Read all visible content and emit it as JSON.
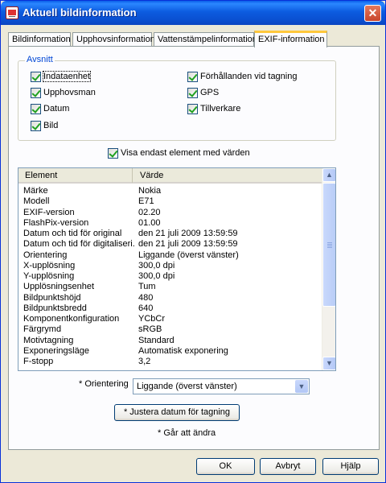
{
  "window": {
    "title": "Aktuell bildinformation",
    "close_glyph": "✕"
  },
  "tabs": [
    {
      "label": "Bildinformation"
    },
    {
      "label": "Upphovsinformation"
    },
    {
      "label": "Vattenstämpelinformation"
    },
    {
      "label": "EXIF-information",
      "active": true
    }
  ],
  "sections": {
    "legend": "Avsnitt",
    "items": [
      {
        "label": "Indataenhet",
        "checked": true
      },
      {
        "label": "Upphovsman",
        "checked": true
      },
      {
        "label": "Datum",
        "checked": true
      },
      {
        "label": "Bild",
        "checked": true
      },
      {
        "label": "Förhållanden vid tagning",
        "checked": true
      },
      {
        "label": "GPS",
        "checked": true
      },
      {
        "label": "Tillverkare",
        "checked": true
      }
    ]
  },
  "show_only_values": {
    "label": "Visa endast element med värden",
    "checked": true
  },
  "list": {
    "columns": [
      "Element",
      "Värde"
    ],
    "rows": [
      {
        "element": "Märke",
        "value": "Nokia"
      },
      {
        "element": "Modell",
        "value": "E71"
      },
      {
        "element": "EXIF-version",
        "value": "02.20"
      },
      {
        "element": "FlashPix-version",
        "value": "01.00"
      },
      {
        "element": "Datum och tid för original",
        "value": "den 21 juli 2009 13:59:59"
      },
      {
        "element": "Datum och tid för digitaliseri...",
        "value": "den 21 juli 2009 13:59:59"
      },
      {
        "element": "Orientering",
        "value": "Liggande (överst vänster)"
      },
      {
        "element": "X-upplösning",
        "value": "300,0 dpi"
      },
      {
        "element": "Y-upplösning",
        "value": "300,0 dpi"
      },
      {
        "element": "Upplösningsenhet",
        "value": "Tum"
      },
      {
        "element": "Bildpunktshöjd",
        "value": "480"
      },
      {
        "element": "Bildpunktsbredd",
        "value": "640"
      },
      {
        "element": "Komponentkonfiguration",
        "value": "YCbCr"
      },
      {
        "element": "Färgrymd",
        "value": "sRGB"
      },
      {
        "element": "Motivtagning",
        "value": "Standard"
      },
      {
        "element": "Exponeringsläge",
        "value": "Automatisk exponering"
      },
      {
        "element": "F-stopp",
        "value": "3,2"
      }
    ]
  },
  "orientation": {
    "label": "* Orientering",
    "selected": "Liggande (överst vänster)"
  },
  "adjust_button": "* Justera datum för tagning",
  "editable_note": "* Går att ändra",
  "footer": {
    "ok": "OK",
    "cancel": "Avbryt",
    "help": "Hjälp"
  }
}
